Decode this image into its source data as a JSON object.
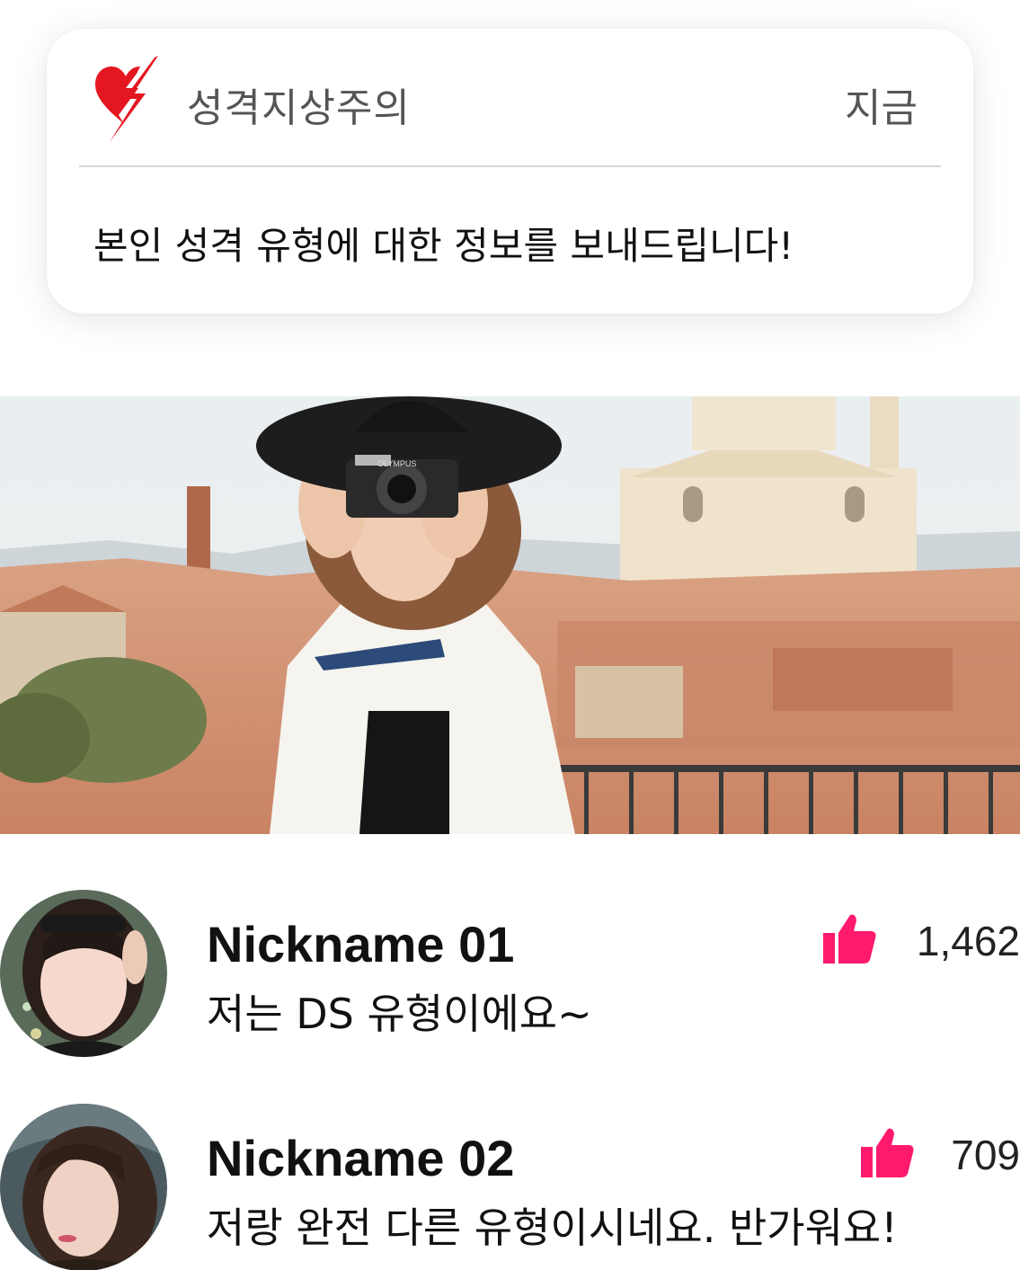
{
  "notification": {
    "app_name": "성격지상주의",
    "time": "지금",
    "message": "본인 성격 유형에 대한 정보를 보내드립니다!",
    "logo_icon": "heart-lightning-icon",
    "brand_color": "#e4161f"
  },
  "banner": {
    "image": "woman-with-camera-photo",
    "camera_brand": "OLYMPUS"
  },
  "comments": [
    {
      "nickname": "Nickname 01",
      "text": "저는 DS 유형이에요~",
      "likes": "1,462",
      "like_icon": "thumbs-up-icon"
    },
    {
      "nickname": "Nickname 02",
      "text": "저랑 완전 다른 유형이시네요. 반가워요!",
      "likes": "709",
      "like_icon": "thumbs-up-icon"
    }
  ],
  "colors": {
    "like": "#ff1a6e",
    "text": "#111111",
    "muted": "#555555"
  }
}
